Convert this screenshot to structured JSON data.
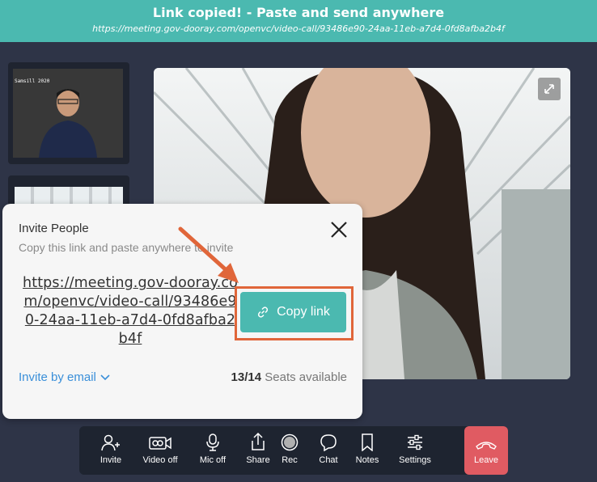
{
  "banner": {
    "title": "Link copied! - Paste and send anywhere",
    "url": "https://meeting.gov-dooray.com/openvc/video-call/93486e90-24aa-11eb-a7d4-0fd8afba2b4f"
  },
  "thumbnails": [
    {
      "room_label": "Samsill 2020"
    },
    {
      "room_label": ""
    }
  ],
  "invite_modal": {
    "title": "Invite People",
    "subtitle": "Copy this link and paste anywhere to invite",
    "link": "https://meeting.gov-dooray.com/openvc/video-call/93486e90-24aa-11eb-a7d4-0fd8afba2b4f",
    "copy_button": "Copy link",
    "invite_by_email": "Invite by email",
    "seats_used": "13/14",
    "seats_label": "Seats available"
  },
  "toolbar": {
    "items": [
      {
        "label": "Invite",
        "icon": "add-person-icon"
      },
      {
        "label": "Video off",
        "icon": "video-camera-icon"
      },
      {
        "label": "Mic off",
        "icon": "microphone-icon"
      },
      {
        "label": "Share",
        "icon": "share-icon"
      },
      {
        "label": "Rec",
        "icon": "record-icon"
      },
      {
        "label": "Chat",
        "icon": "chat-bubble-icon"
      },
      {
        "label": "Notes",
        "icon": "bookmark-icon"
      },
      {
        "label": "Settings",
        "icon": "sliders-icon"
      }
    ],
    "leave": {
      "label": "Leave",
      "icon": "hang-up-icon"
    }
  },
  "colors": {
    "accent": "#4bb9b0",
    "background": "#2e3447",
    "leave": "#e05b62",
    "highlight": "#e0663a",
    "link_blue": "#3a8fd9"
  }
}
